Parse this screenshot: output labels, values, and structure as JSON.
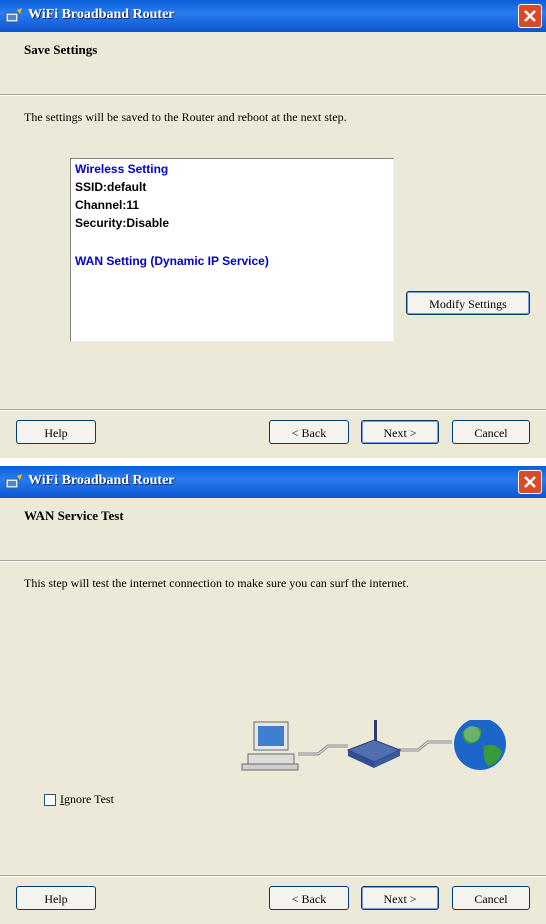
{
  "window1": {
    "title": "WiFi Broadband Router",
    "header": "Save Settings",
    "description": "The settings will be saved to the Router and reboot at the next step.",
    "summary": {
      "wireless_heading": "Wireless Setting",
      "ssid": "SSID:default",
      "channel": "Channel:11",
      "security": "Security:Disable",
      "wan_heading": "WAN Setting  (Dynamic IP Service)"
    },
    "modify_button": "Modify Settings",
    "buttons": {
      "help": "Help",
      "back": "< Back",
      "next": "Next >",
      "cancel": "Cancel"
    }
  },
  "window2": {
    "title": "WiFi Broadband Router",
    "header": "WAN Service Test",
    "description": "This step will test the internet connection to make sure you can surf the internet.",
    "ignore_test_first": "I",
    "ignore_test_rest": "gnore Test",
    "ignore_test_checked": false,
    "buttons": {
      "help": "Help",
      "back": "< Back",
      "next": "Next >",
      "cancel": "Cancel"
    }
  },
  "colors": {
    "titlebar": "#0a5ed7",
    "dialog_bg": "#ece9d8",
    "summary_blue": "#0000c8",
    "close_red": "#d84a2a"
  },
  "icons": [
    "app-icon",
    "close-icon",
    "computer-icon",
    "router-icon",
    "globe-icon"
  ]
}
